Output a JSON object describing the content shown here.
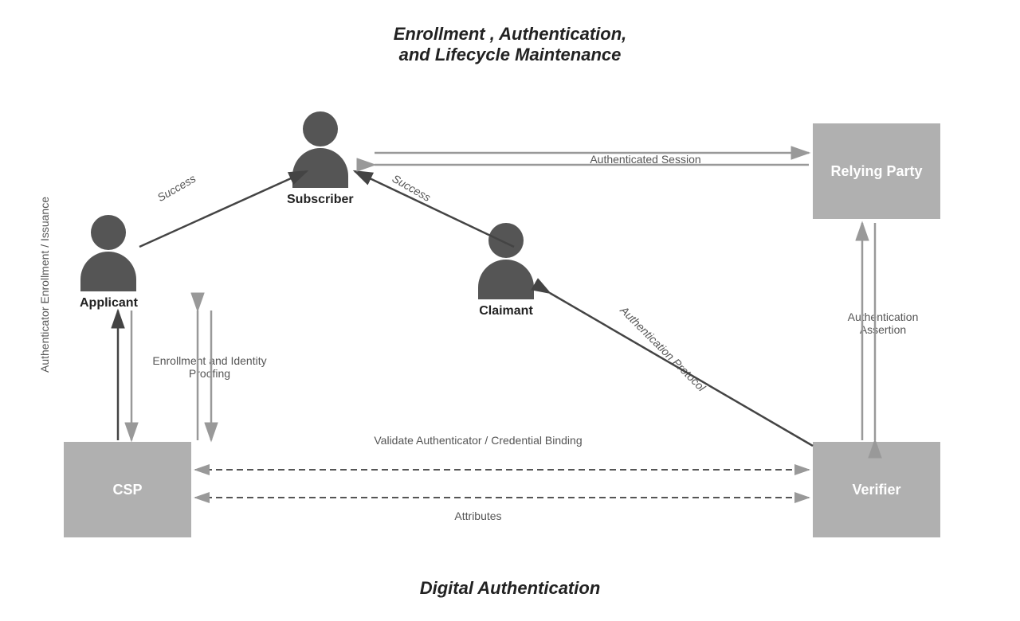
{
  "title": {
    "line1": "Enrollment ,  Authentication,",
    "line2": "and Lifecycle Maintenance"
  },
  "subtitle": "Digital Authentication",
  "boxes": {
    "csp": "CSP",
    "verifier": "Verifier",
    "relying_party": "Relying Party"
  },
  "persons": {
    "applicant": "Applicant",
    "subscriber": "Subscriber",
    "claimant": "Claimant"
  },
  "annotations": {
    "success_applicant_subscriber": "Success",
    "success_claimant_subscriber": "Success",
    "authenticated_session": "Authenticated\nSession",
    "enrollment_identity_proofing": "Enrollment and\nIdentity Proofing",
    "authenticator_enrollment_issuance": "Authenticator\nEnrollment /\nIssuance",
    "authentication_protocol": "Authentication Protocol",
    "authentication_assertion": "Authentication\nAssertion",
    "validate_authenticator": "Validate Authenticator / Credential Binding",
    "attributes": "Attributes"
  }
}
